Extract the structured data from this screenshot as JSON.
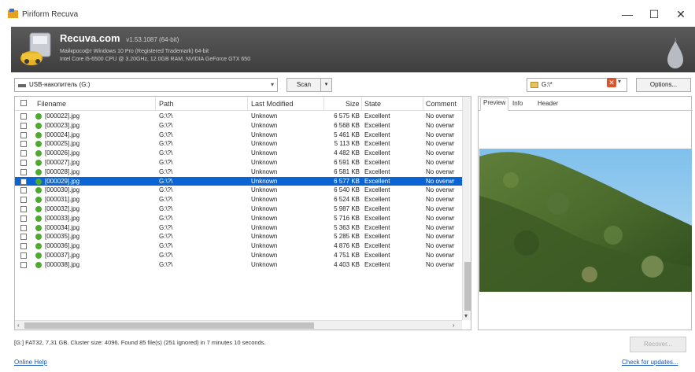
{
  "window": {
    "title": "Piriform Recuva",
    "minimize": "—",
    "maximize": "☐",
    "close": "✕"
  },
  "header": {
    "app_name": "Recuva.com",
    "version": "v1.53.1087 (64-bit)",
    "os_line": "Майкрософт Windows 10 Pro (Registered Trademark) 64-bit",
    "hw_line": "Intel Core i5-6500 CPU @ 3.20GHz, 12.0GB RAM, NVIDIA GeForce GTX 650"
  },
  "toolbar": {
    "drive": "USB-накопитель (G:)",
    "scan_label": "Scan",
    "path_value": "G:\\*",
    "options_label": "Options..."
  },
  "columns": {
    "filename": "Filename",
    "path": "Path",
    "modified": "Last Modified",
    "size": "Size",
    "state": "State",
    "comment": "Comment"
  },
  "files": [
    {
      "name": "[000022].jpg",
      "path": "G:\\?\\",
      "modified": "Unknown",
      "size": "6 575 KB",
      "state": "Excellent",
      "comment": "No overwr"
    },
    {
      "name": "[000023].jpg",
      "path": "G:\\?\\",
      "modified": "Unknown",
      "size": "6 568 KB",
      "state": "Excellent",
      "comment": "No overwr"
    },
    {
      "name": "[000024].jpg",
      "path": "G:\\?\\",
      "modified": "Unknown",
      "size": "5 461 KB",
      "state": "Excellent",
      "comment": "No overwr"
    },
    {
      "name": "[000025].jpg",
      "path": "G:\\?\\",
      "modified": "Unknown",
      "size": "5 113 KB",
      "state": "Excellent",
      "comment": "No overwr"
    },
    {
      "name": "[000026].jpg",
      "path": "G:\\?\\",
      "modified": "Unknown",
      "size": "4 482 KB",
      "state": "Excellent",
      "comment": "No overwr"
    },
    {
      "name": "[000027].jpg",
      "path": "G:\\?\\",
      "modified": "Unknown",
      "size": "6 591 KB",
      "state": "Excellent",
      "comment": "No overwr"
    },
    {
      "name": "[000028].jpg",
      "path": "G:\\?\\",
      "modified": "Unknown",
      "size": "6 581 KB",
      "state": "Excellent",
      "comment": "No overwr"
    },
    {
      "name": "[000029].jpg",
      "path": "G:\\?\\",
      "modified": "Unknown",
      "size": "6 577 KB",
      "state": "Excellent",
      "comment": "No overwr"
    },
    {
      "name": "[000030].jpg",
      "path": "G:\\?\\",
      "modified": "Unknown",
      "size": "6 540 KB",
      "state": "Excellent",
      "comment": "No overwr"
    },
    {
      "name": "[000031].jpg",
      "path": "G:\\?\\",
      "modified": "Unknown",
      "size": "6 524 KB",
      "state": "Excellent",
      "comment": "No overwr"
    },
    {
      "name": "[000032].jpg",
      "path": "G:\\?\\",
      "modified": "Unknown",
      "size": "5 987 KB",
      "state": "Excellent",
      "comment": "No overwr"
    },
    {
      "name": "[000033].jpg",
      "path": "G:\\?\\",
      "modified": "Unknown",
      "size": "5 716 KB",
      "state": "Excellent",
      "comment": "No overwr"
    },
    {
      "name": "[000034].jpg",
      "path": "G:\\?\\",
      "modified": "Unknown",
      "size": "5 363 KB",
      "state": "Excellent",
      "comment": "No overwr"
    },
    {
      "name": "[000035].jpg",
      "path": "G:\\?\\",
      "modified": "Unknown",
      "size": "5 285 KB",
      "state": "Excellent",
      "comment": "No overwr"
    },
    {
      "name": "[000036].jpg",
      "path": "G:\\?\\",
      "modified": "Unknown",
      "size": "4 876 KB",
      "state": "Excellent",
      "comment": "No overwr"
    },
    {
      "name": "[000037].jpg",
      "path": "G:\\?\\",
      "modified": "Unknown",
      "size": "4 751 KB",
      "state": "Excellent",
      "comment": "No overwr"
    },
    {
      "name": "[000038].jpg",
      "path": "G:\\?\\",
      "modified": "Unknown",
      "size": "4 403 KB",
      "state": "Excellent",
      "comment": "No overwr"
    }
  ],
  "selected_file": "[000029].jpg",
  "preview": {
    "tabs": [
      "Preview",
      "Info",
      "Header"
    ],
    "active_tab": "Preview"
  },
  "status": {
    "text": "[G:] FAT32, 7,31 GB. Cluster size: 4096. Found 85 file(s) (251 ignored) in 7 minutes 10 seconds.",
    "recover_label": "Recover..."
  },
  "footer": {
    "help_link": "Online Help",
    "update_link": "Check for updates..."
  },
  "colors": {
    "header_bg": "#4a4a4a",
    "selection": "#0a64d4",
    "status_dot": "#4caa2f",
    "link": "#1a55b0"
  }
}
